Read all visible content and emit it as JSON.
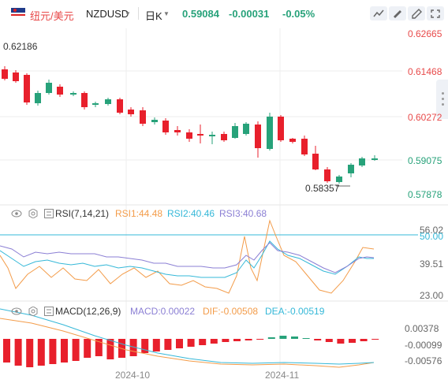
{
  "toolbar": {
    "symbol_cn": "纽元/美元",
    "symbol": "NZDUSD",
    "period": "日K",
    "last": "0.59084",
    "change": "-0.00031",
    "change_pct": "-0.05%"
  },
  "price_axis": [
    "0.62665",
    "0.61468",
    "0.60272",
    "0.59075",
    "0.57878"
  ],
  "annotations": {
    "high": "0.62186",
    "low": "0.58357"
  },
  "rsi": {
    "title": "RSI(7,14,21)",
    "rsi1": "RSI1:44.48",
    "rsi2": "RSI2:40.46",
    "rsi3": "RSI3:40.68",
    "axis": [
      "56.02",
      "50.00",
      "39.51",
      "23.00"
    ]
  },
  "macd": {
    "title": "MACD(12,26,9)",
    "macd": "MACD:0.00022",
    "dif": "DIF:-0.00508",
    "dea": "DEA:-0.00519",
    "axis": [
      "0.00378",
      "-0.00099",
      "-0.00576"
    ]
  },
  "x_axis": [
    "2024-10",
    "2024-11"
  ],
  "colors": {
    "up": "#27a27a",
    "down": "#e8202c",
    "rsi1": "#f39c4a",
    "rsi2": "#35b8d8",
    "rsi3": "#8b7fd4",
    "dif": "#f39c4a",
    "dea": "#35b8d8"
  },
  "icons": [
    "us-nz-flag-icon",
    "chevron-down-icon",
    "line-chart-icon",
    "draw-icon",
    "pen-icon",
    "expand-icon",
    "eye-icon",
    "gear-icon",
    "list-icon"
  ]
}
